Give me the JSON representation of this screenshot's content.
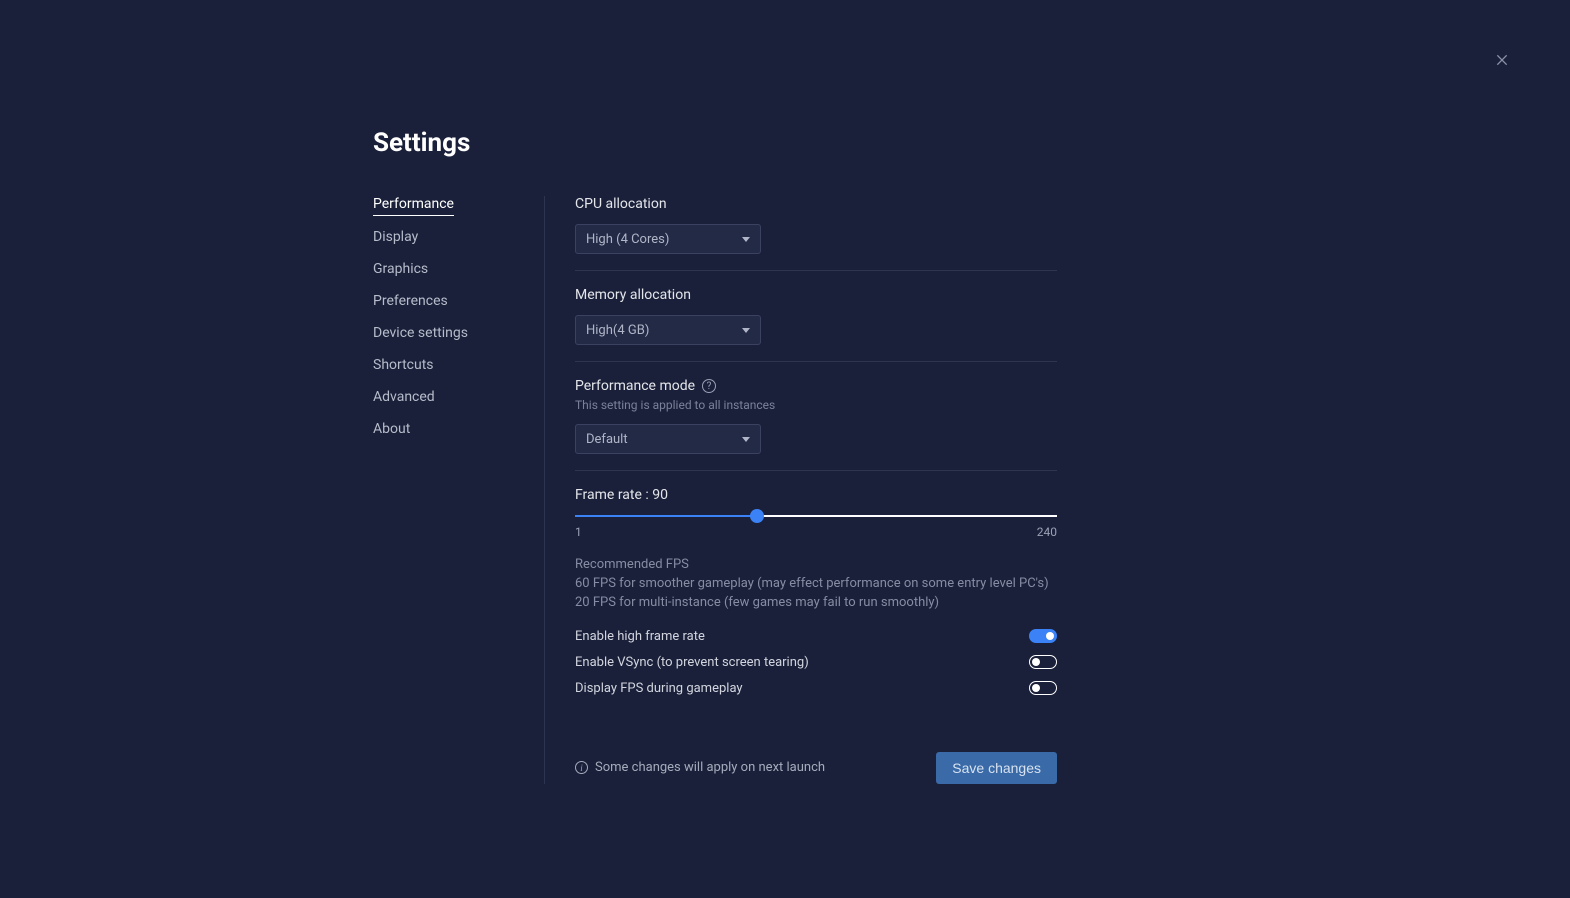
{
  "title": "Settings",
  "sidebar": {
    "items": [
      {
        "label": "Performance",
        "active": true
      },
      {
        "label": "Display",
        "active": false
      },
      {
        "label": "Graphics",
        "active": false
      },
      {
        "label": "Preferences",
        "active": false
      },
      {
        "label": "Device settings",
        "active": false
      },
      {
        "label": "Shortcuts",
        "active": false
      },
      {
        "label": "Advanced",
        "active": false
      },
      {
        "label": "About",
        "active": false
      }
    ]
  },
  "cpu": {
    "label": "CPU allocation",
    "value": "High (4 Cores)"
  },
  "memory": {
    "label": "Memory allocation",
    "value": "High(4 GB)"
  },
  "perfmode": {
    "label": "Performance mode",
    "sub": "This setting is applied to all instances",
    "value": "Default"
  },
  "framerate": {
    "label": "Frame rate : 90",
    "min": "1",
    "max": "240",
    "value": 90,
    "percent": 37.7,
    "rec_title": "Recommended FPS",
    "rec_body": "60 FPS for smoother gameplay (may effect performance on some entry level PC's) 20 FPS for multi-instance (few games may fail to run smoothly)"
  },
  "toggles": {
    "high_fps": {
      "label": "Enable high frame rate",
      "on": true
    },
    "vsync": {
      "label": "Enable VSync (to prevent screen tearing)",
      "on": false
    },
    "show_fps": {
      "label": "Display FPS during gameplay",
      "on": false
    }
  },
  "footer": {
    "note": "Some changes will apply on next launch",
    "save": "Save changes"
  }
}
